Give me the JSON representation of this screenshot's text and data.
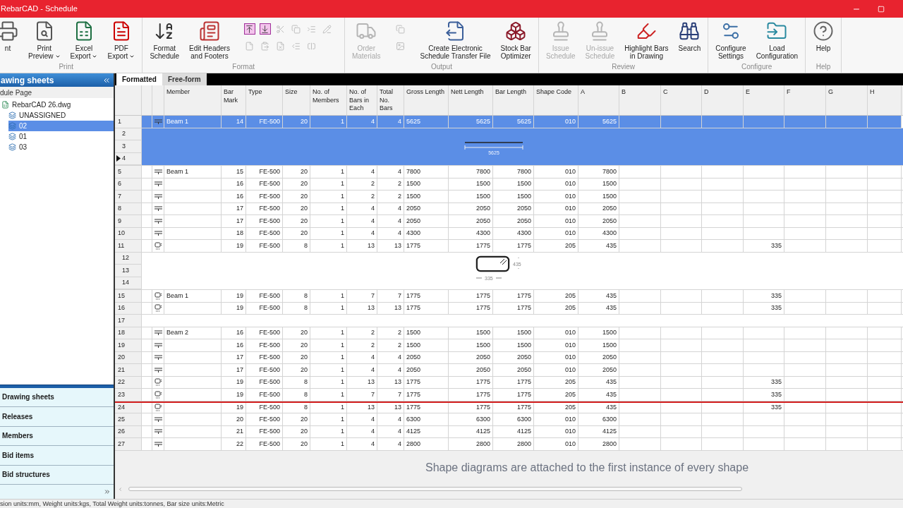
{
  "window": {
    "title": "RebarCAD - Schedule"
  },
  "ribbon": [
    {
      "label": "Print",
      "buttons": [
        {
          "lines": [
            "nt"
          ],
          "disabled": false,
          "dropdown": false
        },
        {
          "lines": [
            "Print",
            "Preview"
          ],
          "disabled": false,
          "dropdown": true
        },
        {
          "lines": [
            "Excel",
            "Export"
          ],
          "disabled": false,
          "dropdown": true
        },
        {
          "lines": [
            "PDF",
            "Export"
          ],
          "disabled": false,
          "dropdown": true
        }
      ]
    },
    {
      "label": "Format",
      "buttons": [
        {
          "lines": [
            "Format",
            "Schedule"
          ],
          "disabled": false,
          "dropdown": false
        },
        {
          "lines": [
            "Edit Headers",
            "and Footers"
          ],
          "disabled": false,
          "dropdown": false
        }
      ],
      "small": [
        {
          "disabled": false
        },
        {
          "disabled": false
        },
        {
          "disabled": true
        },
        {
          "disabled": true
        },
        {
          "disabled": true
        },
        {
          "disabled": true
        },
        {
          "disabled": true
        },
        {
          "disabled": true
        },
        {
          "disabled": true
        },
        {
          "disabled": true
        },
        {
          "disabled": true
        }
      ]
    },
    {
      "label": "Output",
      "buttons": [
        {
          "lines": [
            "Order",
            "Materials"
          ],
          "disabled": true,
          "dropdown": false
        },
        {
          "lines": [
            "Create Electronic",
            "Schedule Transfer File"
          ],
          "disabled": false,
          "dropdown": false
        },
        {
          "lines": [
            "Stock Bar",
            "Optimizer"
          ],
          "disabled": false,
          "dropdown": false
        }
      ],
      "small": [
        {
          "disabled": true
        },
        {
          "disabled": true
        }
      ]
    },
    {
      "label": "Review",
      "buttons": [
        {
          "lines": [
            "Issue",
            "Schedule"
          ],
          "disabled": true,
          "dropdown": false
        },
        {
          "lines": [
            "Un-issue",
            "Schedule"
          ],
          "disabled": true,
          "dropdown": false
        },
        {
          "lines": [
            "Highlight Bars",
            "in Drawing"
          ],
          "disabled": false,
          "dropdown": false
        },
        {
          "lines": [
            "Search"
          ],
          "disabled": false,
          "dropdown": false
        }
      ]
    },
    {
      "label": "Configure",
      "buttons": [
        {
          "lines": [
            "Configure",
            "Settings"
          ],
          "disabled": false,
          "dropdown": false
        },
        {
          "lines": [
            "Load",
            "Configuration"
          ],
          "disabled": false,
          "dropdown": false
        }
      ]
    },
    {
      "label": "Help",
      "buttons": [
        {
          "lines": [
            "Help"
          ],
          "disabled": false,
          "dropdown": false
        }
      ]
    }
  ],
  "sidebar": {
    "title": "awing sheets",
    "subtitle": "dule Page",
    "tree": [
      {
        "label": "RebarCAD 26.dwg",
        "kind": "file",
        "selected": false,
        "children": [
          {
            "label": "UNASSIGNED",
            "kind": "sheet",
            "selected": false
          },
          {
            "label": "02",
            "kind": "sheet",
            "selected": true
          },
          {
            "label": "01",
            "kind": "sheet",
            "selected": false
          },
          {
            "label": "03",
            "kind": "sheet",
            "selected": false
          }
        ]
      }
    ],
    "nav": [
      "Drawing sheets",
      "Releases",
      "Members",
      "Bid items",
      "Bid structures"
    ]
  },
  "tabs": [
    {
      "label": "Formatted",
      "selected": true
    },
    {
      "label": "Free-form",
      "selected": false
    }
  ],
  "table": {
    "columns": [
      "Member",
      "Bar Mark",
      "Type",
      "Size",
      "No. of Members",
      "No. of Bars in Each",
      "Total No. Bars",
      "Gross Length",
      "Nett Length",
      "Bar Length",
      "Shape Code",
      "A",
      "B",
      "C",
      "D",
      "E",
      "F",
      "G",
      "H"
    ],
    "rows": [
      {
        "kind": "straight",
        "number": "1",
        "selected": true,
        "drop_line": false,
        "cells": [
          "Beam 1",
          "14",
          "FE-500",
          "20",
          "1",
          "4",
          "4",
          "5625",
          "5625",
          "5625",
          "010",
          "5625",
          "",
          "",
          "",
          "",
          "",
          "",
          ""
        ]
      },
      {
        "kind": "diagram",
        "selected": true,
        "numbers": [
          {
            "label": "2",
            "current": false
          },
          {
            "label": "3",
            "current": false
          },
          {
            "label": "4",
            "current": true
          }
        ],
        "dims": [
          "5625"
        ]
      },
      {
        "kind": "straight",
        "number": "5",
        "selected": false,
        "drop_line": false,
        "cells": [
          "Beam 1",
          "15",
          "FE-500",
          "20",
          "1",
          "4",
          "4",
          "7800",
          "7800",
          "7800",
          "010",
          "7800",
          "",
          "",
          "",
          "",
          "",
          "",
          ""
        ]
      },
      {
        "kind": "straight",
        "number": "6",
        "selected": false,
        "drop_line": false,
        "cells": [
          "",
          "16",
          "FE-500",
          "20",
          "1",
          "2",
          "2",
          "1500",
          "1500",
          "1500",
          "010",
          "1500",
          "",
          "",
          "",
          "",
          "",
          "",
          ""
        ]
      },
      {
        "kind": "straight",
        "number": "7",
        "selected": false,
        "drop_line": false,
        "cells": [
          "",
          "16",
          "FE-500",
          "20",
          "1",
          "2",
          "2",
          "1500",
          "1500",
          "1500",
          "010",
          "1500",
          "",
          "",
          "",
          "",
          "",
          "",
          ""
        ]
      },
      {
        "kind": "straight",
        "number": "8",
        "selected": false,
        "drop_line": false,
        "cells": [
          "",
          "17",
          "FE-500",
          "20",
          "1",
          "4",
          "4",
          "2050",
          "2050",
          "2050",
          "010",
          "2050",
          "",
          "",
          "",
          "",
          "",
          "",
          ""
        ]
      },
      {
        "kind": "straight",
        "number": "9",
        "selected": false,
        "drop_line": false,
        "cells": [
          "",
          "17",
          "FE-500",
          "20",
          "1",
          "4",
          "4",
          "2050",
          "2050",
          "2050",
          "010",
          "2050",
          "",
          "",
          "",
          "",
          "",
          "",
          ""
        ]
      },
      {
        "kind": "straight",
        "number": "10",
        "selected": false,
        "drop_line": false,
        "cells": [
          "",
          "18",
          "FE-500",
          "20",
          "1",
          "4",
          "4",
          "4300",
          "4300",
          "4300",
          "010",
          "4300",
          "",
          "",
          "",
          "",
          "",
          "",
          ""
        ]
      },
      {
        "kind": "link",
        "number": "11",
        "selected": false,
        "drop_line": false,
        "cells": [
          "",
          "19",
          "FE-500",
          "8",
          "1",
          "13",
          "13",
          "1775",
          "1775",
          "1775",
          "205",
          "435",
          "",
          "",
          "",
          "335",
          "",
          "",
          ""
        ]
      },
      {
        "kind": "diagram",
        "selected": false,
        "numbers": [
          {
            "label": "12",
            "current": false
          },
          {
            "label": "13",
            "current": false
          },
          {
            "label": "14",
            "current": false
          }
        ],
        "dims": [
          "435",
          "335"
        ]
      },
      {
        "kind": "link",
        "number": "15",
        "selected": false,
        "drop_line": false,
        "cells": [
          "Beam 1",
          "19",
          "FE-500",
          "8",
          "1",
          "7",
          "7",
          "1775",
          "1775",
          "1775",
          "205",
          "435",
          "",
          "",
          "",
          "335",
          "",
          "",
          ""
        ]
      },
      {
        "kind": "link",
        "number": "16",
        "selected": false,
        "drop_line": false,
        "cells": [
          "",
          "19",
          "FE-500",
          "8",
          "1",
          "13",
          "13",
          "1775",
          "1775",
          "1775",
          "205",
          "435",
          "",
          "",
          "",
          "335",
          "",
          "",
          ""
        ]
      },
      {
        "kind": "empty",
        "number": "17"
      },
      {
        "kind": "straight",
        "number": "18",
        "selected": false,
        "drop_line": false,
        "cells": [
          "Beam 2",
          "16",
          "FE-500",
          "20",
          "1",
          "2",
          "2",
          "1500",
          "1500",
          "1500",
          "010",
          "1500",
          "",
          "",
          "",
          "",
          "",
          "",
          ""
        ]
      },
      {
        "kind": "straight",
        "number": "19",
        "selected": false,
        "drop_line": false,
        "cells": [
          "",
          "16",
          "FE-500",
          "20",
          "1",
          "2",
          "2",
          "1500",
          "1500",
          "1500",
          "010",
          "1500",
          "",
          "",
          "",
          "",
          "",
          "",
          ""
        ]
      },
      {
        "kind": "straight",
        "number": "20",
        "selected": false,
        "drop_line": false,
        "cells": [
          "",
          "17",
          "FE-500",
          "20",
          "1",
          "4",
          "4",
          "2050",
          "2050",
          "2050",
          "010",
          "2050",
          "",
          "",
          "",
          "",
          "",
          "",
          ""
        ]
      },
      {
        "kind": "straight",
        "number": "21",
        "selected": false,
        "drop_line": false,
        "cells": [
          "",
          "17",
          "FE-500",
          "20",
          "1",
          "4",
          "4",
          "2050",
          "2050",
          "2050",
          "010",
          "2050",
          "",
          "",
          "",
          "",
          "",
          "",
          ""
        ]
      },
      {
        "kind": "link",
        "number": "22",
        "selected": false,
        "drop_line": false,
        "cells": [
          "",
          "19",
          "FE-500",
          "8",
          "1",
          "13",
          "13",
          "1775",
          "1775",
          "1775",
          "205",
          "435",
          "",
          "",
          "",
          "335",
          "",
          "",
          ""
        ]
      },
      {
        "kind": "link",
        "number": "23",
        "selected": false,
        "drop_line": false,
        "cells": [
          "",
          "19",
          "FE-500",
          "8",
          "1",
          "7",
          "7",
          "1775",
          "1775",
          "1775",
          "205",
          "435",
          "",
          "",
          "",
          "335",
          "",
          "",
          ""
        ]
      },
      {
        "kind": "link",
        "number": "24",
        "selected": false,
        "drop_line": true,
        "cells": [
          "",
          "19",
          "FE-500",
          "8",
          "1",
          "13",
          "13",
          "1775",
          "1775",
          "1775",
          "205",
          "435",
          "",
          "",
          "",
          "335",
          "",
          "",
          ""
        ]
      },
      {
        "kind": "straight",
        "number": "25",
        "selected": false,
        "drop_line": false,
        "cells": [
          "",
          "20",
          "FE-500",
          "20",
          "1",
          "4",
          "4",
          "6300",
          "6300",
          "6300",
          "010",
          "6300",
          "",
          "",
          "",
          "",
          "",
          "",
          ""
        ]
      },
      {
        "kind": "straight",
        "number": "26",
        "selected": false,
        "drop_line": false,
        "cells": [
          "",
          "21",
          "FE-500",
          "20",
          "1",
          "4",
          "4",
          "4125",
          "4125",
          "4125",
          "010",
          "4125",
          "",
          "",
          "",
          "",
          "",
          "",
          ""
        ]
      },
      {
        "kind": "straight",
        "number": "27",
        "selected": false,
        "drop_line": false,
        "cells": [
          "",
          "22",
          "FE-500",
          "20",
          "1",
          "4",
          "4",
          "2800",
          "2800",
          "2800",
          "010",
          "2800",
          "",
          "",
          "",
          "",
          "",
          "",
          ""
        ]
      }
    ]
  },
  "caption": "Shape diagrams are attached to the first instance of every shape",
  "status_bar": "sion units:mm, Weight units:kgs, Total Weight units:tonnes, Bar size units:Metric"
}
